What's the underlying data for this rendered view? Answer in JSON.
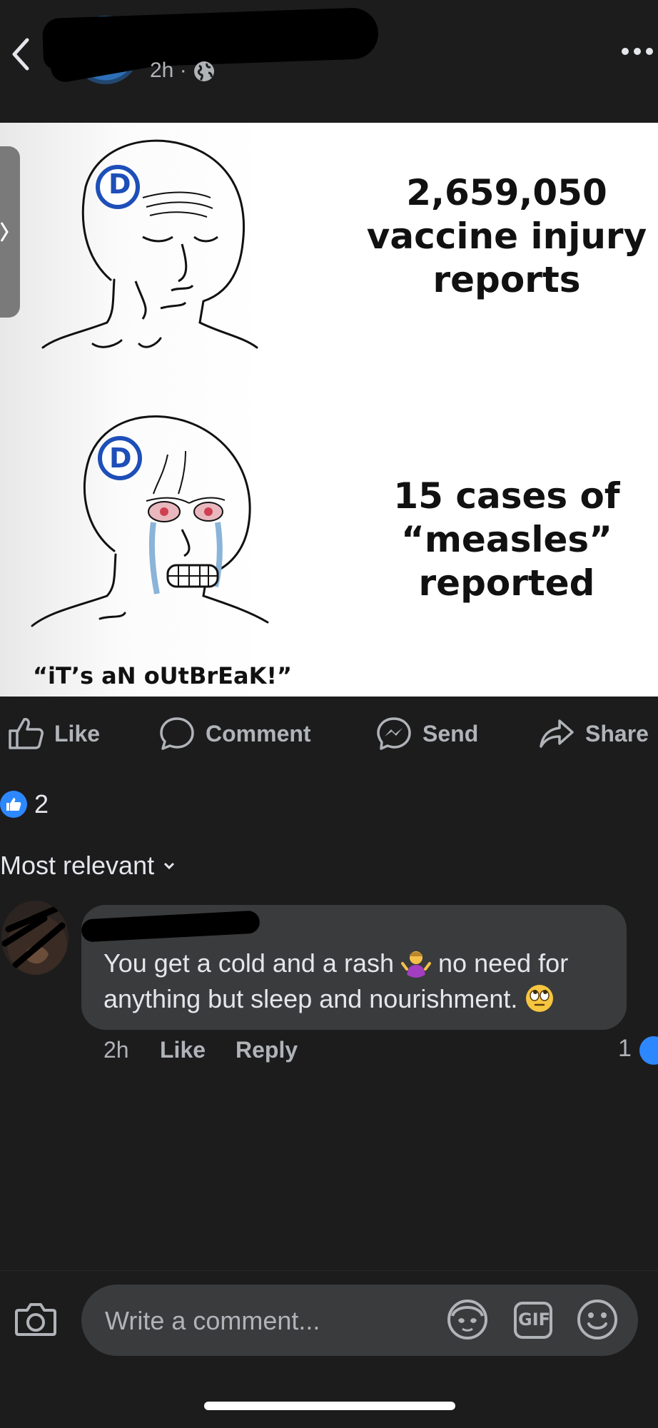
{
  "header": {
    "post_time": "2h ·",
    "back_icon": "chevron-left-icon",
    "privacy_icon": "globe-icon",
    "more_icon": "more-icon"
  },
  "meme": {
    "top_text": "2,659,050 vaccine injury reports",
    "bottom_text": "15 cases of “measles” reported",
    "caption": "“iT’s aN oUtBrEaK!”",
    "badge_letter_top": "D",
    "badge_letter_bottom": "D"
  },
  "actions": {
    "like": "Like",
    "comment": "Comment",
    "send": "Send",
    "share": "Share"
  },
  "reactions": {
    "count": "2"
  },
  "sort": {
    "label": "Most relevant"
  },
  "comment": {
    "text_part1": "You get a cold and a rash",
    "text_part2": "no need for anything but sleep and nourishment.",
    "emoji1": "shrug-emoji",
    "emoji2": "eye-roll-emoji",
    "time": "2h",
    "like_label": "Like",
    "reply_label": "Reply",
    "like_count": "1"
  },
  "composer": {
    "placeholder": "Write a comment...",
    "gif_label": "GIF"
  },
  "colors": {
    "background": "#1c1c1d",
    "bubble": "#3a3b3c",
    "accent": "#2d88ff",
    "muted_text": "#b0b3b8",
    "badge_blue": "#1e4fb8"
  }
}
